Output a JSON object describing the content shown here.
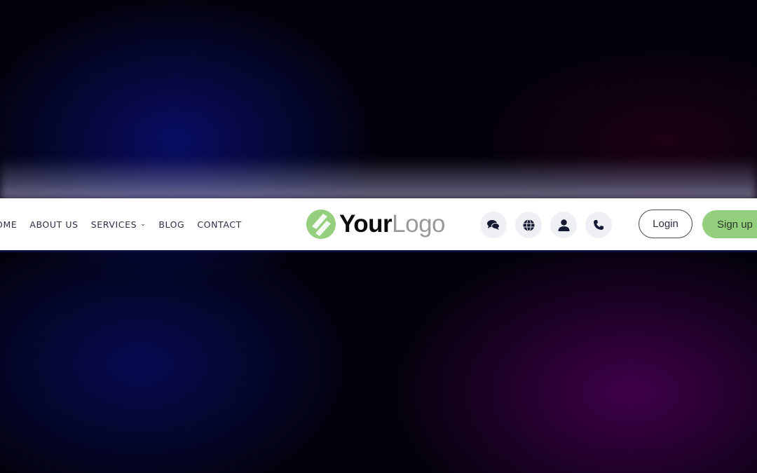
{
  "nav": {
    "items": [
      {
        "label": "HOME"
      },
      {
        "label": "ABOUT US"
      },
      {
        "label": "SERVICES",
        "has_dropdown": true
      },
      {
        "label": "BLOG"
      },
      {
        "label": "CONTACT"
      }
    ]
  },
  "logo": {
    "part1": "Your",
    "part2": "Logo",
    "mark_color": "#93cf7c"
  },
  "icon_buttons": [
    "chat-icon",
    "globe-icon",
    "user-icon",
    "phone-icon"
  ],
  "auth": {
    "login_label": "Login",
    "signup_label": "Sign up",
    "signup_color": "#93cf7c"
  }
}
